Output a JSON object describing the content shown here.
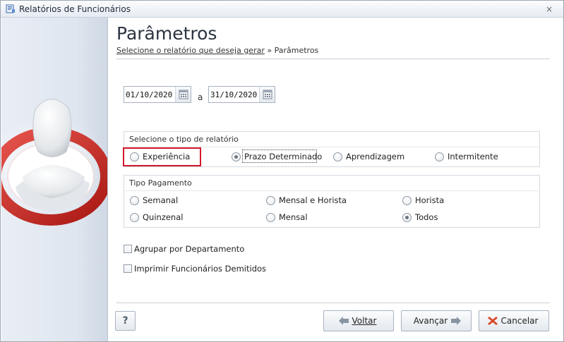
{
  "window": {
    "title": "Relatórios de Funcionários",
    "close_glyph": "×"
  },
  "header": {
    "title": "Parâmetros",
    "breadcrumb_link": "Selecione o relatório que deseja gerar",
    "breadcrumb_sep": " » ",
    "breadcrumb_current": "Parâmetros"
  },
  "dates": {
    "start": "01/10/2020",
    "separator": "a",
    "end": "31/10/2020",
    "calendar_icon": "calendar-icon"
  },
  "report_type": {
    "legend": "Selecione o tipo de relatório",
    "options": [
      {
        "label": "Experiência",
        "checked": false
      },
      {
        "label": "Prazo Determinado",
        "checked": true
      },
      {
        "label": "Aprendizagem",
        "checked": false
      },
      {
        "label": "Intermitente",
        "checked": false
      }
    ]
  },
  "payment_type": {
    "legend": "Tipo Pagamento",
    "options": [
      {
        "label": "Semanal",
        "checked": false
      },
      {
        "label": "Mensal e Horista",
        "checked": false
      },
      {
        "label": "Horista",
        "checked": false
      },
      {
        "label": "Quinzenal",
        "checked": false
      },
      {
        "label": "Mensal",
        "checked": false
      },
      {
        "label": "Todos",
        "checked": true
      }
    ]
  },
  "options": {
    "group_by_department": {
      "label": "Agrupar por Departamento",
      "checked": false
    },
    "print_dismissed": {
      "label": "Imprimir Funcionários Demitidos",
      "checked": false
    }
  },
  "footer": {
    "help_label": "?",
    "back_label": "Voltar",
    "next_label": "Avançar",
    "cancel_label": "Cancelar"
  },
  "colors": {
    "highlight": "#d5182b",
    "accent_red": "#c9302c",
    "arrow_gray": "#8a94a0"
  }
}
